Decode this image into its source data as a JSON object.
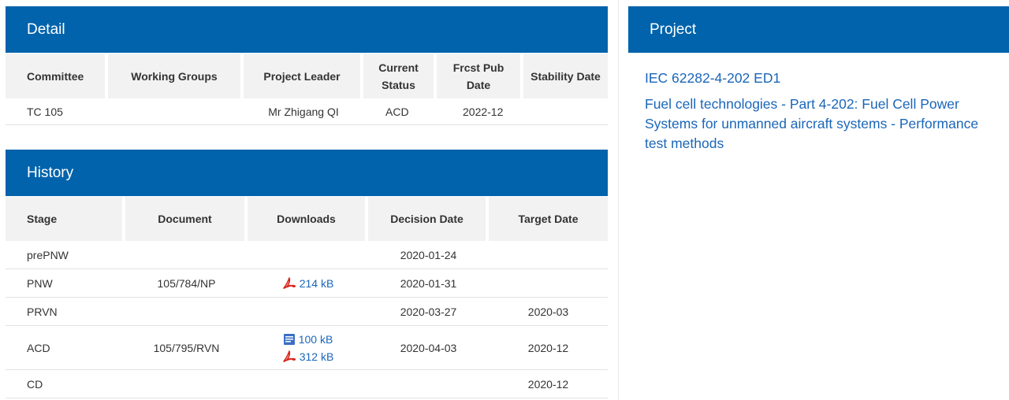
{
  "detail": {
    "title": "Detail",
    "columns": [
      "Committee",
      "Working Groups",
      "Project Leader",
      "Current Status",
      "Frcst Pub Date",
      "Stability Date"
    ],
    "row": {
      "committee": "TC 105",
      "working_groups": "",
      "project_leader": "Mr Zhigang QI",
      "current_status": "ACD",
      "frcst_pub_date": "2022-12",
      "stability_date": ""
    }
  },
  "history": {
    "title": "History",
    "columns": [
      "Stage",
      "Document",
      "Downloads",
      "Decision Date",
      "Target Date"
    ],
    "rows": [
      {
        "stage": "prePNW",
        "document": "",
        "downloads": [],
        "decision_date": "2020-01-24",
        "target_date": ""
      },
      {
        "stage": "PNW",
        "document": "105/784/NP",
        "downloads": [
          {
            "icon": "pdf-icon",
            "size": "214 kB"
          }
        ],
        "decision_date": "2020-01-31",
        "target_date": ""
      },
      {
        "stage": "PRVN",
        "document": "",
        "downloads": [],
        "decision_date": "2020-03-27",
        "target_date": "2020-03"
      },
      {
        "stage": "ACD",
        "document": "105/795/RVN",
        "downloads": [
          {
            "icon": "word-doc-icon",
            "size": "100 kB"
          },
          {
            "icon": "pdf-icon",
            "size": "312 kB"
          }
        ],
        "decision_date": "2020-04-03",
        "target_date": "2020-12"
      },
      {
        "stage": "CD",
        "document": "",
        "downloads": [],
        "decision_date": "",
        "target_date": "2020-12"
      }
    ]
  },
  "project": {
    "title": "Project",
    "reference": "IEC 62282-4-202 ED1",
    "description": "Fuel cell technologies - Part 4-202: Fuel Cell Power Systems for unmanned aircraft systems - Performance test methods"
  },
  "colors": {
    "header_bg": "#0063ac",
    "link": "#1a66b8",
    "table_header_bg": "#f2f2f2",
    "pdf_red": "#d9261c"
  }
}
